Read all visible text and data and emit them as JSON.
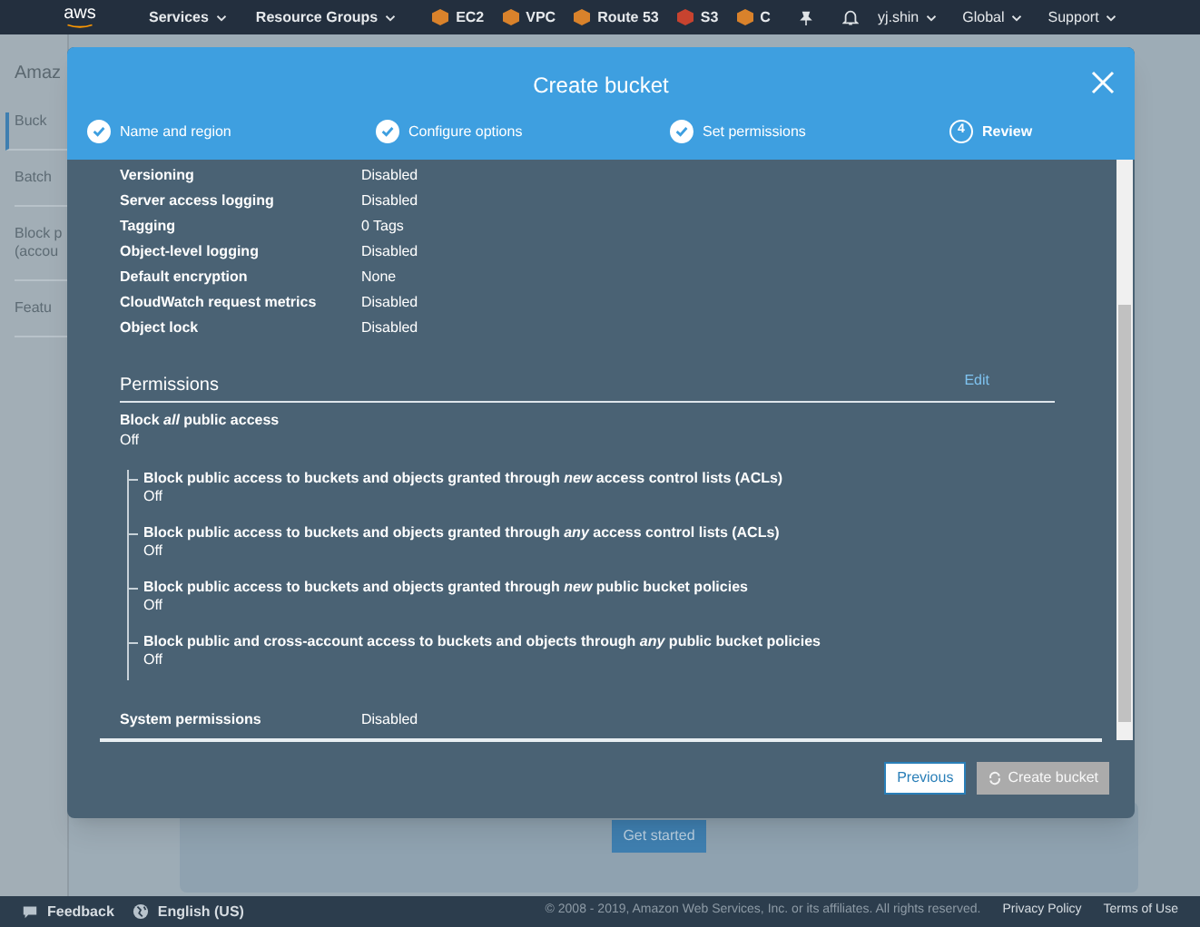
{
  "nav": {
    "logo": "aws",
    "menus": [
      {
        "label": "Services",
        "kind": "menu"
      },
      {
        "label": "Resource Groups",
        "kind": "menu"
      }
    ],
    "shortcuts": [
      {
        "label": "EC2",
        "color": "#d9822b"
      },
      {
        "label": "VPC",
        "color": "#d9822b"
      },
      {
        "label": "Route 53",
        "color": "#d9822b"
      },
      {
        "label": "S3",
        "color": "#c7432f"
      },
      {
        "label": "C",
        "color": "#d9822b"
      }
    ],
    "right": [
      {
        "label": "yj.shin"
      },
      {
        "label": "Global"
      },
      {
        "label": "Support"
      }
    ]
  },
  "sidebar": {
    "title": "Amaz",
    "items": [
      {
        "label": "Buck",
        "selected": true
      },
      {
        "label": "Batch",
        "selected": false
      },
      {
        "label": "Block p\n(accou",
        "selected": false
      },
      {
        "label": "Featu",
        "selected": false
      }
    ]
  },
  "page": {
    "button": "Get started"
  },
  "modal": {
    "title": "Create bucket",
    "steps": [
      {
        "label": "Name and region",
        "done": true
      },
      {
        "label": "Configure options",
        "done": true
      },
      {
        "label": "Set permissions",
        "done": true
      },
      {
        "label": "Review",
        "done": false,
        "number": "4"
      }
    ],
    "properties": [
      {
        "label": "Versioning",
        "value": "Disabled"
      },
      {
        "label": "Server access logging",
        "value": "Disabled"
      },
      {
        "label": "Tagging",
        "value": "0 Tags"
      },
      {
        "label": "Object-level logging",
        "value": "Disabled"
      },
      {
        "label": "Default encryption",
        "value": "None"
      },
      {
        "label": "CloudWatch request metrics",
        "value": "Disabled"
      },
      {
        "label": "Object lock",
        "value": "Disabled"
      }
    ],
    "permissions": {
      "title": "Permissions",
      "edit": "Edit",
      "block": {
        "label": "Block *all* public access",
        "value": "Off",
        "children": [
          {
            "label": "Block public access to buckets and objects granted through *new* access control lists (ACLs)",
            "value": "Off"
          },
          {
            "label": "Block public access to buckets and objects granted through *any* access control lists (ACLs)",
            "value": "Off"
          },
          {
            "label": "Block public access to buckets and objects granted through *new* public bucket policies",
            "value": "Off"
          },
          {
            "label": "Block public and cross-account access to buckets and objects through *any* public bucket policies",
            "value": "Off"
          }
        ]
      },
      "system": {
        "label": "System permissions",
        "value": "Disabled"
      }
    },
    "buttons": [
      {
        "label": "Previous",
        "disabled": false
      },
      {
        "label": "Create bucket",
        "disabled": true
      }
    ]
  },
  "footer": {
    "feedback": "Feedback",
    "language": "English (US)",
    "copyright": "© 2008 - 2019, Amazon Web Services, Inc. or its affiliates. All rights reserved.",
    "links": [
      "Privacy Policy",
      "Terms of Use"
    ]
  }
}
